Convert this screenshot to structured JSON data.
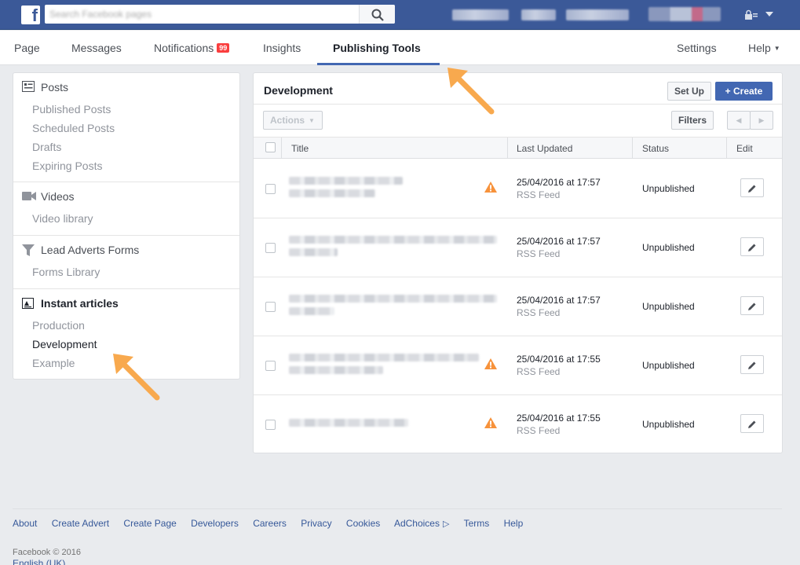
{
  "topbar": {
    "logo_letter": "f",
    "search_value": "Search Facebook pages"
  },
  "page_nav": {
    "items": [
      {
        "label": "Page"
      },
      {
        "label": "Messages"
      },
      {
        "label": "Notifications",
        "badge": "99"
      },
      {
        "label": "Insights"
      },
      {
        "label": "Publishing Tools",
        "active": true
      },
      {
        "label": "Settings"
      },
      {
        "label": "Help"
      }
    ]
  },
  "sidebar": {
    "sections": [
      {
        "title": "Posts",
        "icon": "posts-icon",
        "links": [
          "Published Posts",
          "Scheduled Posts",
          "Drafts",
          "Expiring Posts"
        ]
      },
      {
        "title": "Videos",
        "icon": "video-camera-icon",
        "links": [
          "Video library"
        ]
      },
      {
        "title": "Lead Adverts Forms",
        "icon": "filter-funnel-icon",
        "links": [
          "Forms Library"
        ]
      },
      {
        "title": "Instant articles",
        "icon": "instant-articles-icon",
        "links": [
          "Production",
          "Development",
          "Example"
        ],
        "current": "Development"
      }
    ]
  },
  "main": {
    "title": "Development",
    "setup_label": "Set Up",
    "create_label": "Create",
    "actions_label": "Actions",
    "filters_label": "Filters",
    "columns": {
      "title": "Title",
      "updated": "Last Updated",
      "status": "Status",
      "edit": "Edit"
    },
    "rows": [
      {
        "updated": "25/04/2016 at 17:57",
        "source": "RSS Feed",
        "status": "Unpublished",
        "warning": true
      },
      {
        "updated": "25/04/2016 at 17:57",
        "source": "RSS Feed",
        "status": "Unpublished",
        "warning": false
      },
      {
        "updated": "25/04/2016 at 17:57",
        "source": "RSS Feed",
        "status": "Unpublished",
        "warning": false
      },
      {
        "updated": "25/04/2016 at 17:55",
        "source": "RSS Feed",
        "status": "Unpublished",
        "warning": true
      },
      {
        "updated": "25/04/2016 at 17:55",
        "source": "RSS Feed",
        "status": "Unpublished",
        "warning": true
      }
    ]
  },
  "footer": {
    "links": [
      "About",
      "Create Advert",
      "Create Page",
      "Developers",
      "Careers",
      "Privacy",
      "Cookies",
      "AdChoices",
      "Terms",
      "Help"
    ],
    "copyright": "Facebook © 2016",
    "language": "English (UK)"
  },
  "colors": {
    "brand": "#3b5998",
    "accent": "#4267b2",
    "warning": "#f7923b",
    "arrow": "#f8a94e",
    "badge": "#fa3e3e"
  }
}
